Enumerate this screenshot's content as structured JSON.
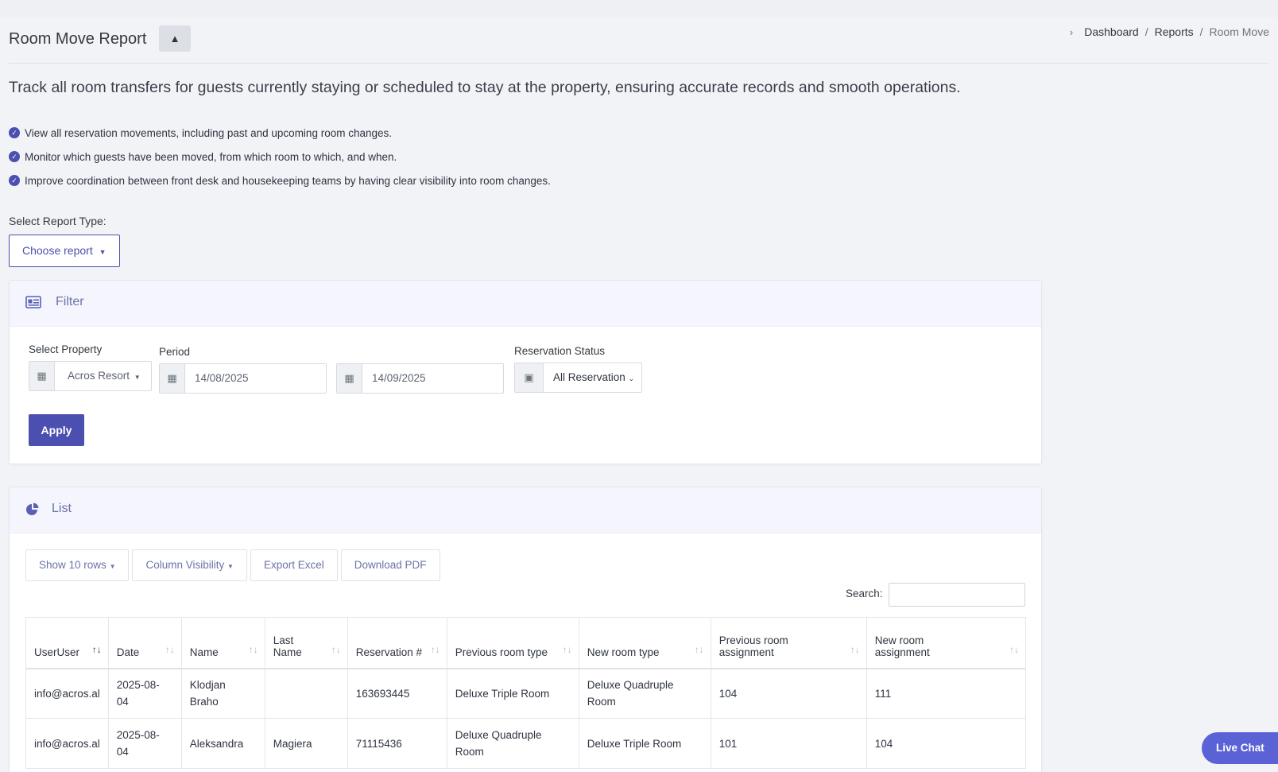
{
  "header": {
    "title": "Room Move Report",
    "collapse_icon": "▲",
    "breadcrumb": [
      "Dashboard",
      "Reports",
      "Room Move"
    ]
  },
  "intro": "Track all room transfers for guests currently staying or scheduled to stay at the property, ensuring accurate records and smooth operations.",
  "bullets": [
    "View all reservation movements, including past and upcoming room changes.",
    "Monitor which guests have been moved, from which room to which, and when.",
    "Improve coordination between front desk and housekeeping teams by having clear visibility into room changes."
  ],
  "report_type": {
    "label": "Select Report Type:",
    "button": "Choose report"
  },
  "filter": {
    "title": "Filter",
    "icon": "id-card-icon",
    "property_label": "Select Property",
    "property_value": "Acros Resort",
    "period_label": "Period",
    "date_from": "14/08/2025",
    "date_to": "14/09/2025",
    "status_label": "Reservation Status",
    "status_value": "All Reservation",
    "apply": "Apply"
  },
  "list": {
    "title": "List",
    "icon": "pie-chart-icon",
    "toolbar": [
      "Show 10 rows",
      "Column Visibility",
      "Export Excel",
      "Download PDF"
    ],
    "search_label": "Search:",
    "columns": [
      "UserUser",
      "Date",
      "Name",
      "Last Name",
      "Reservation #",
      "Previous room type",
      "New room type",
      "Previous room assignment",
      "New room assignment"
    ],
    "rows": [
      [
        "info@acros.al",
        "2025-08-04",
        "Klodjan Braho",
        "",
        "163693445",
        "Deluxe Triple Room",
        "Deluxe Quadruple Room",
        "104",
        "111"
      ],
      [
        "info@acros.al",
        "2025-08-04",
        "Aleksandra",
        "Magiera",
        "71115436",
        "Deluxe Quadruple Room",
        "Deluxe Triple Room",
        "101",
        "104"
      ]
    ]
  },
  "live_chat": "Live Chat",
  "colors": {
    "accent": "#4b4fb0",
    "background": "#f1f3f7",
    "card_header": "#f4f5fd",
    "live_chat": "#5a62d6"
  }
}
